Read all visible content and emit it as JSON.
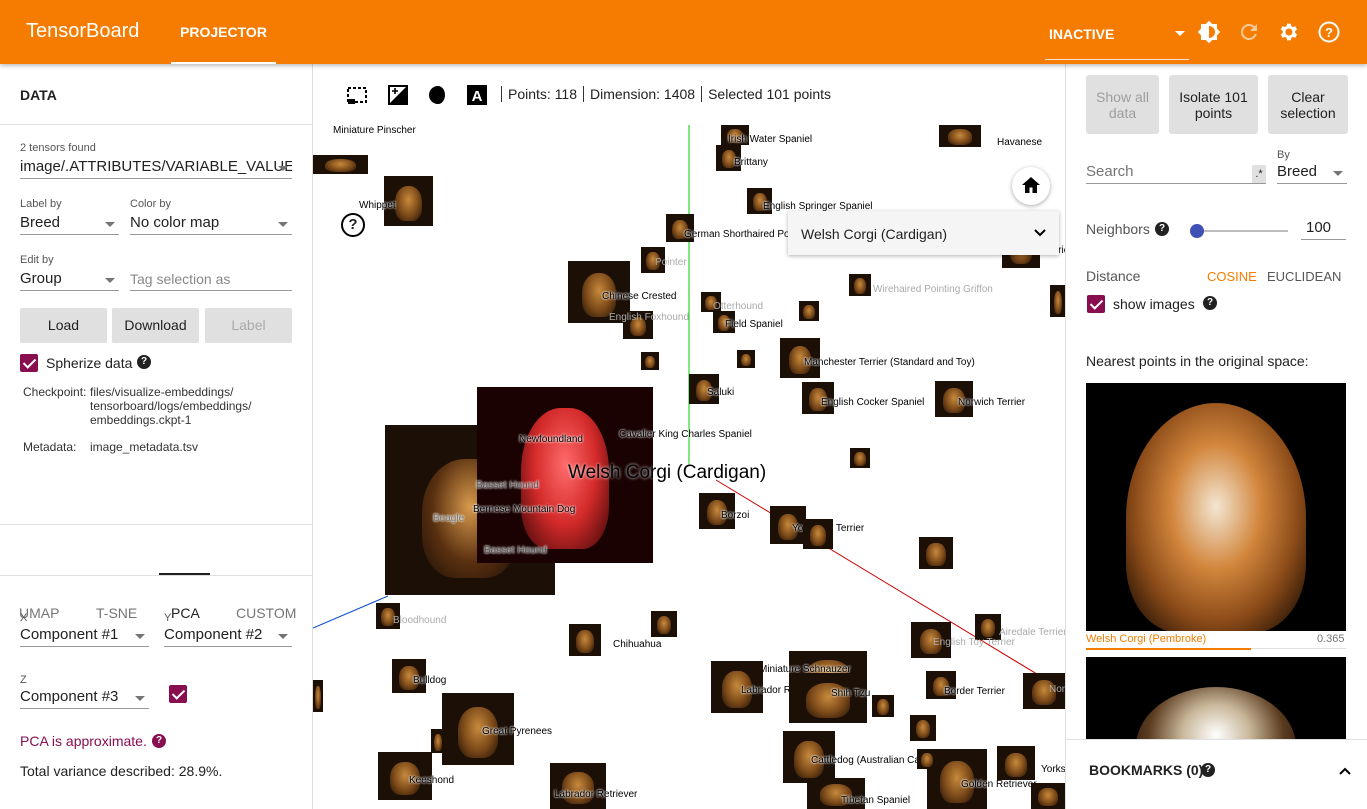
{
  "header": {
    "brand": "TensorBoard",
    "tab": "PROJECTOR",
    "status": "INACTIVE",
    "icons": [
      "theme-icon",
      "refresh-icon",
      "settings-icon",
      "help-icon"
    ]
  },
  "data_panel": {
    "title": "DATA",
    "tensors_found": "2 tensors found",
    "tensor": "image/.ATTRIBUTES/VARIABLE_VALUE",
    "label_by_label": "Label by",
    "label_by": "Breed",
    "color_by_label": "Color by",
    "color_by": "No color map",
    "edit_by_label": "Edit by",
    "edit_by": "Group",
    "tag_placeholder": "Tag selection as",
    "load": "Load",
    "download": "Download",
    "label_btn": "Label",
    "spherize": "Spherize data",
    "checkpoint_label": "Checkpoint:",
    "checkpoint": [
      "files/visualize-embeddings/",
      "tensorboard/logs/embeddings/",
      "embeddings.ckpt-1"
    ],
    "metadata_label": "Metadata:",
    "metadata": "image_metadata.tsv"
  },
  "method_tabs": [
    "UMAP",
    "T-SNE",
    "PCA",
    "CUSTOM"
  ],
  "pca": {
    "x_label": "X",
    "x": "Component #1",
    "y_label": "Y",
    "y": "Component #2",
    "z_label": "Z",
    "z": "Component #3",
    "approx": "PCA is approximate.",
    "variance": "Total variance described: 28.9%."
  },
  "toolbar": {
    "points": "Points: 118",
    "dimension": "Dimension: 1408",
    "selected": "Selected 101 points"
  },
  "plot": {
    "selected_label": "Welsh Corgi (Cardigan)",
    "dropdown": "Welsh Corgi (Cardigan)",
    "labels": [
      "Miniature Pinscher",
      "Whippet",
      "Irish Water Spaniel",
      "Brittany",
      "Havanese",
      "English Springer Spaniel",
      "German Shorthaired Pointer",
      "Fox Terrier",
      "Pointer",
      "Chinese Crested",
      "Wirehaired Pointing Griffon",
      "Otterhound",
      "Field Spaniel",
      "English Foxhound",
      "Manchester Terrier (Standard and Toy)",
      "Saluki",
      "English Cocker Spaniel",
      "Norwich Terrier",
      "Newfoundland",
      "Cavalier King Charles Spaniel",
      "Basset Hound",
      "Beagle",
      "Bernese Mountain Dog",
      "Basset Hound",
      "Borzoi",
      "Yorkshire Terrier",
      "Bloodhound",
      "Chihuahua",
      "Airedale Terrier",
      "English Toy Terrier",
      "Miniature Schnauzer",
      "Labrador Retriever",
      "Shih Tzu",
      "Border Terrier",
      "Bulldog",
      "Great Pyrenees",
      "Keeshond",
      "Labrador Retriever",
      "Cattledog (Australian Cattle Dog)",
      "Golden Retriever",
      "Yorkshire",
      "Tibetan Spaniel",
      "Norfolk"
    ]
  },
  "inspector": {
    "show_all": "Show all data",
    "isolate": "Isolate 101 points",
    "clear": "Clear selection",
    "search_placeholder": "Search",
    "regex": ".*",
    "by_label": "By",
    "by": "Breed",
    "neighbors_label": "Neighbors",
    "neighbors": "100",
    "neighbors_fraction": 0.05,
    "distance_label": "Distance",
    "cosine": "COSINE",
    "euclidean": "EUCLIDEAN",
    "show_images": "show images",
    "nearest_title": "Nearest points in the original space:",
    "nearest": [
      {
        "label": "Welsh Corgi (Pembroke)",
        "value": "0.365"
      }
    ],
    "bookmarks": "BOOKMARKS (0)",
    "accent": "#f57c00"
  }
}
